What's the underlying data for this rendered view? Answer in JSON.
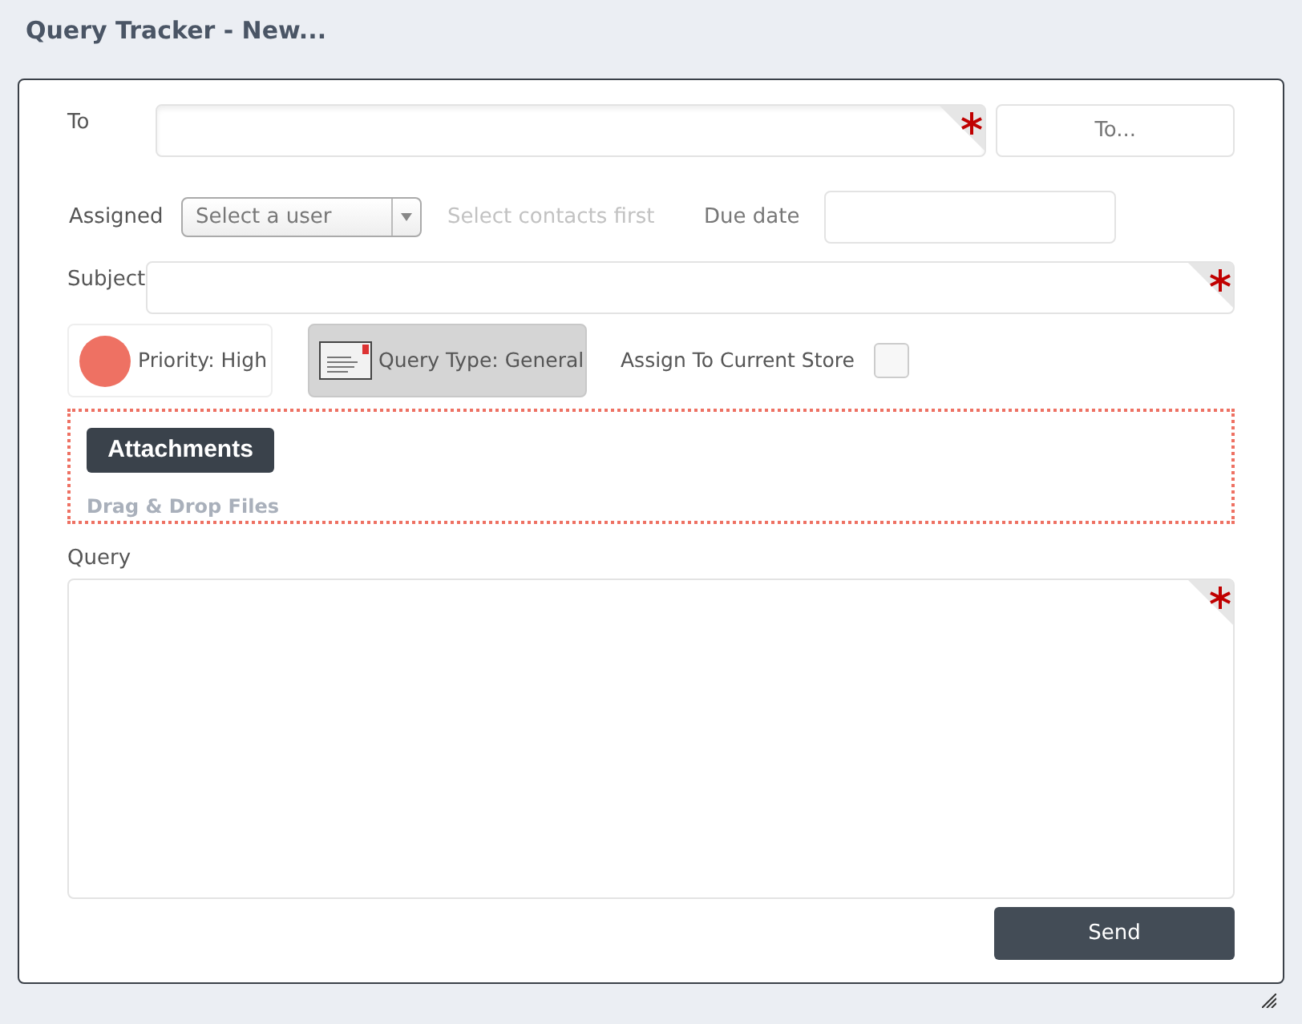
{
  "title": "Query Tracker - New...",
  "to": {
    "label": "To",
    "required": true,
    "button": "To..."
  },
  "assigned": {
    "label": "Assigned",
    "placeholder": "Select a user",
    "hint": "Select contacts first"
  },
  "due_date": {
    "label": "Due date"
  },
  "subject": {
    "label": "Subject",
    "required": true
  },
  "priority": {
    "label": "Priority: High"
  },
  "query_type": {
    "label": "Query Type: General"
  },
  "assign_store": {
    "label": "Assign To Current Store",
    "checked": false
  },
  "attachments": {
    "button": "Attachments",
    "hint": "Drag & Drop Files"
  },
  "query": {
    "label": "Query",
    "required": true
  },
  "send": "Send"
}
